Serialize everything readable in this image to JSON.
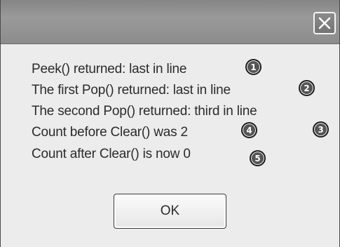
{
  "window": {
    "close_icon": "close-icon"
  },
  "messages": [
    {
      "text": "Peek() returned: last in line",
      "badge": "1"
    },
    {
      "text": "The first Pop() returned: last in line",
      "badge": "2"
    },
    {
      "text": "The second Pop() returned: third in line",
      "badge": "3"
    },
    {
      "text": "Count before Clear() was 2",
      "badge": "4"
    },
    {
      "text": "Count after Clear() is now 0",
      "badge": "5"
    }
  ],
  "buttons": {
    "ok_label": "OK"
  },
  "colors": {
    "titlebar": "#8c8c8c",
    "dialog_background": "#ececec",
    "badge": "#555555"
  }
}
